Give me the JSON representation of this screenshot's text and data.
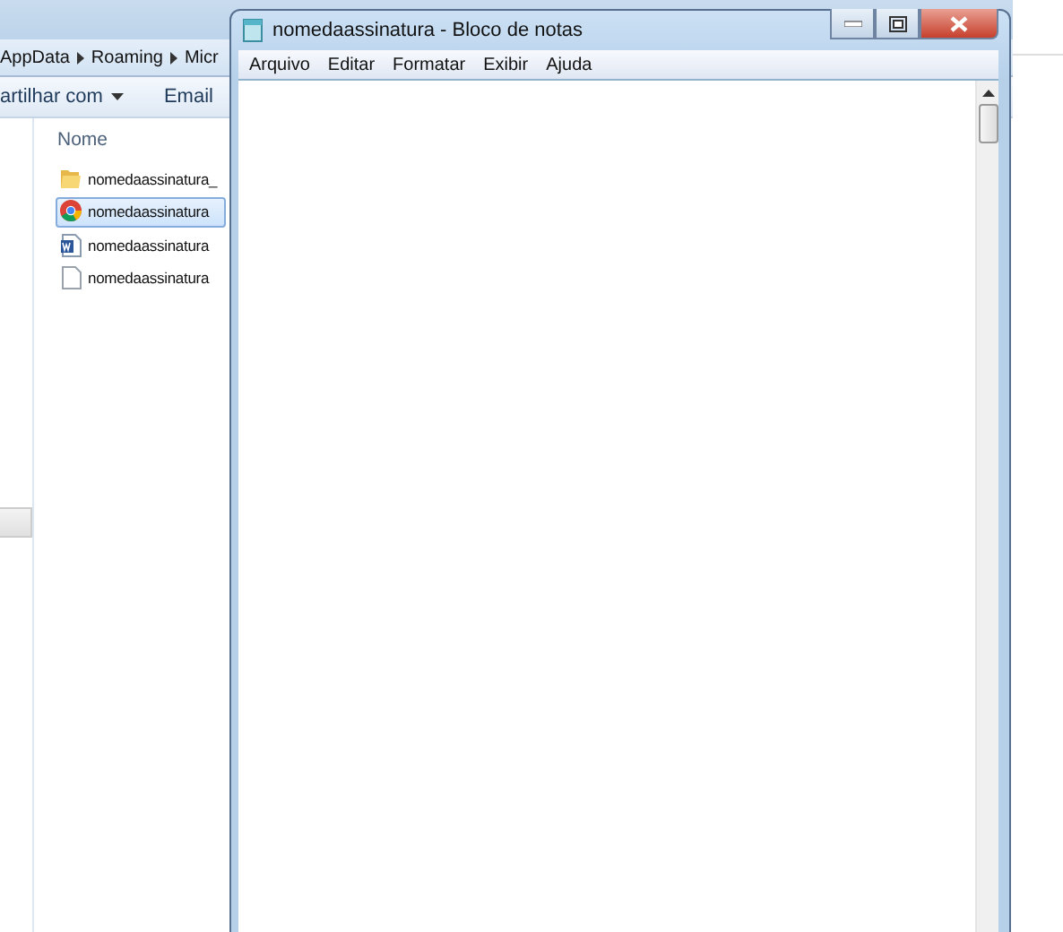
{
  "explorer": {
    "breadcrumbs": [
      "AppData",
      "Roaming",
      "Micr"
    ],
    "toolbar": [
      {
        "label": "artilhar com",
        "kind": "dropdown"
      },
      {
        "label": "Email",
        "kind": "plain"
      }
    ],
    "column_header": "Nome",
    "files": [
      {
        "name": "nomedaassinatura_",
        "kind": "folder",
        "selected": false
      },
      {
        "name": "nomedaassinatura",
        "kind": "browser",
        "selected": true
      },
      {
        "name": "nomedaassinatura",
        "kind": "word",
        "selected": false
      },
      {
        "name": "nomedaassinatura",
        "kind": "text",
        "selected": false
      }
    ]
  },
  "notepad": {
    "title": "nomedaassinatura - Bloco de notas",
    "menu": [
      "Arquivo",
      "Editar",
      "Formatar",
      "Exibir",
      "Ajuda"
    ]
  }
}
